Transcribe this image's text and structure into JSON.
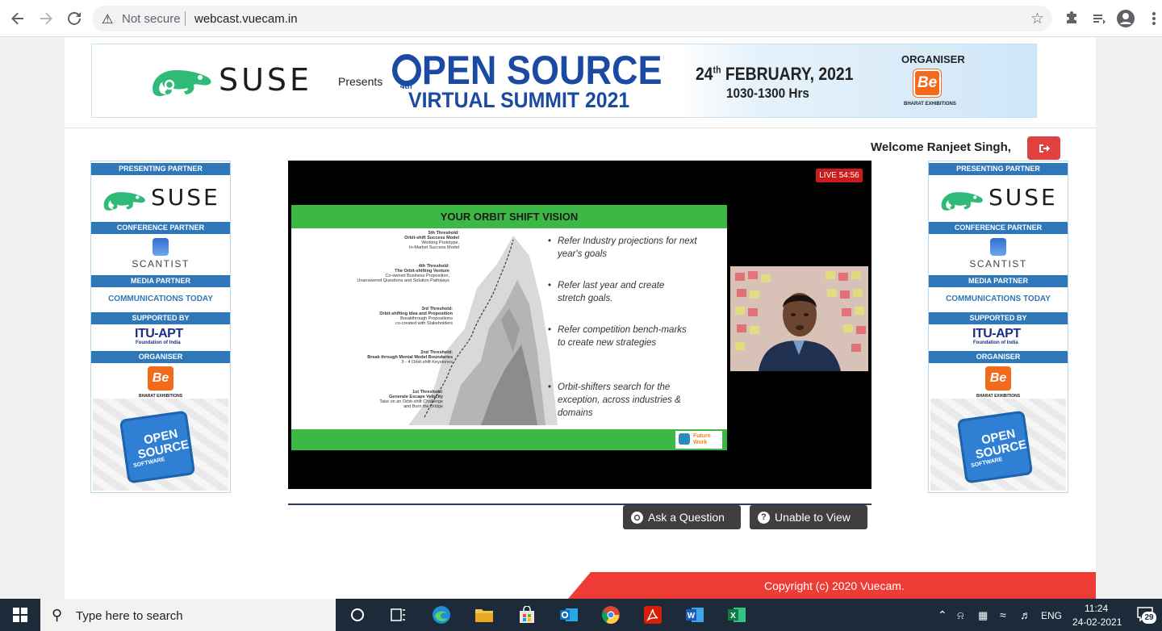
{
  "browser": {
    "security_label": "Not secure",
    "url": "webcast.vuecam.in"
  },
  "banner": {
    "brand": "SUSE",
    "presents": "Presents",
    "title_line1_rest": "PEN SOURCE",
    "title_superscript": "4th",
    "title_line2": "VIRTUAL SUMMIT 2021",
    "date_day": "24",
    "date_suffix": "th",
    "date_rest": "FEBRUARY, 2021",
    "hours": "1030-1300 Hrs",
    "organiser_label": "ORGANISER",
    "organiser_logo": "Be",
    "organiser_name": "BHARAT EXHIBITIONS"
  },
  "welcome_text": "Welcome Ranjeet Singh,",
  "sidebar": {
    "presenting_partner": "PRESENTING PARTNER",
    "suse": "SUSE",
    "conference_partner": "CONFERENCE PARTNER",
    "scantist": "SCANTIST",
    "media_partner": "MEDIA PARTNER",
    "communications_today": "COMMUNICATIONS TODAY",
    "supported_by": "SUPPORTED BY",
    "itu": "ITU-APT",
    "itu_sub": "Foundation of India",
    "organiser": "ORGANISER",
    "be": "Be",
    "be_sub": "BHARAT EXHIBITIONS",
    "puzzle_line1": "OPEN",
    "puzzle_line2": "SOURCE",
    "puzzle_line3": "SOFTWARE"
  },
  "player": {
    "live_badge": "LIVE 54:56",
    "slide": {
      "title": "YOUR ORBIT SHIFT VISION",
      "thresholds": [
        {
          "title": "5th Threshold:",
          "sub1": "Orbit-shift Success Model",
          "sub2": "Working Prototype,",
          "sub3": "In-Market Success Model"
        },
        {
          "title": "4th Threshold:",
          "sub1": "The Orbit-shifting Venture",
          "sub2": "Co-owned Business Proposition,",
          "sub3": "Unanswered Questions and Solution Pathways"
        },
        {
          "title": "3rd Threshold:",
          "sub1": "Orbit-shifting Idea and Proposition",
          "sub2": "Breakthrough Propositions",
          "sub3": "co-created with Stakeholders"
        },
        {
          "title": "2nd Threshold:",
          "sub1": "Break through Mental Model Boundaries",
          "sub2": "3 - 4  Orbit-shift Keystones",
          "sub3": ""
        },
        {
          "title": "1st Threshold:",
          "sub1": "Generate Escape Velocity",
          "sub2": "Take on an Orbit-shift Challenge",
          "sub3": "and Burn the Bridge"
        }
      ],
      "bullets": [
        "Refer Industry projections for next year's goals",
        "Refer last year and create stretch goals.",
        "Refer competition bench-marks to create new strategies",
        "Orbit-shifters search for the exception, across industries & domains"
      ],
      "logo_line1": "Future",
      "logo_line2": "Work"
    }
  },
  "actions": {
    "ask_question": "Ask a Question",
    "unable_to_view": "Unable to View"
  },
  "footer": {
    "copyright": "Copyright (c) 2020 Vuecam."
  },
  "taskbar": {
    "search_placeholder": "Type here to search",
    "language": "ENG",
    "time": "11:24",
    "date": "24-02-2021",
    "notification_count": "29"
  },
  "colors": {
    "brand_blue": "#1b4aa3",
    "partner_blue": "#2e77b8",
    "slide_green": "#3cb944",
    "footer_red": "#ef3b36",
    "button_dark": "#3f3f3f"
  }
}
